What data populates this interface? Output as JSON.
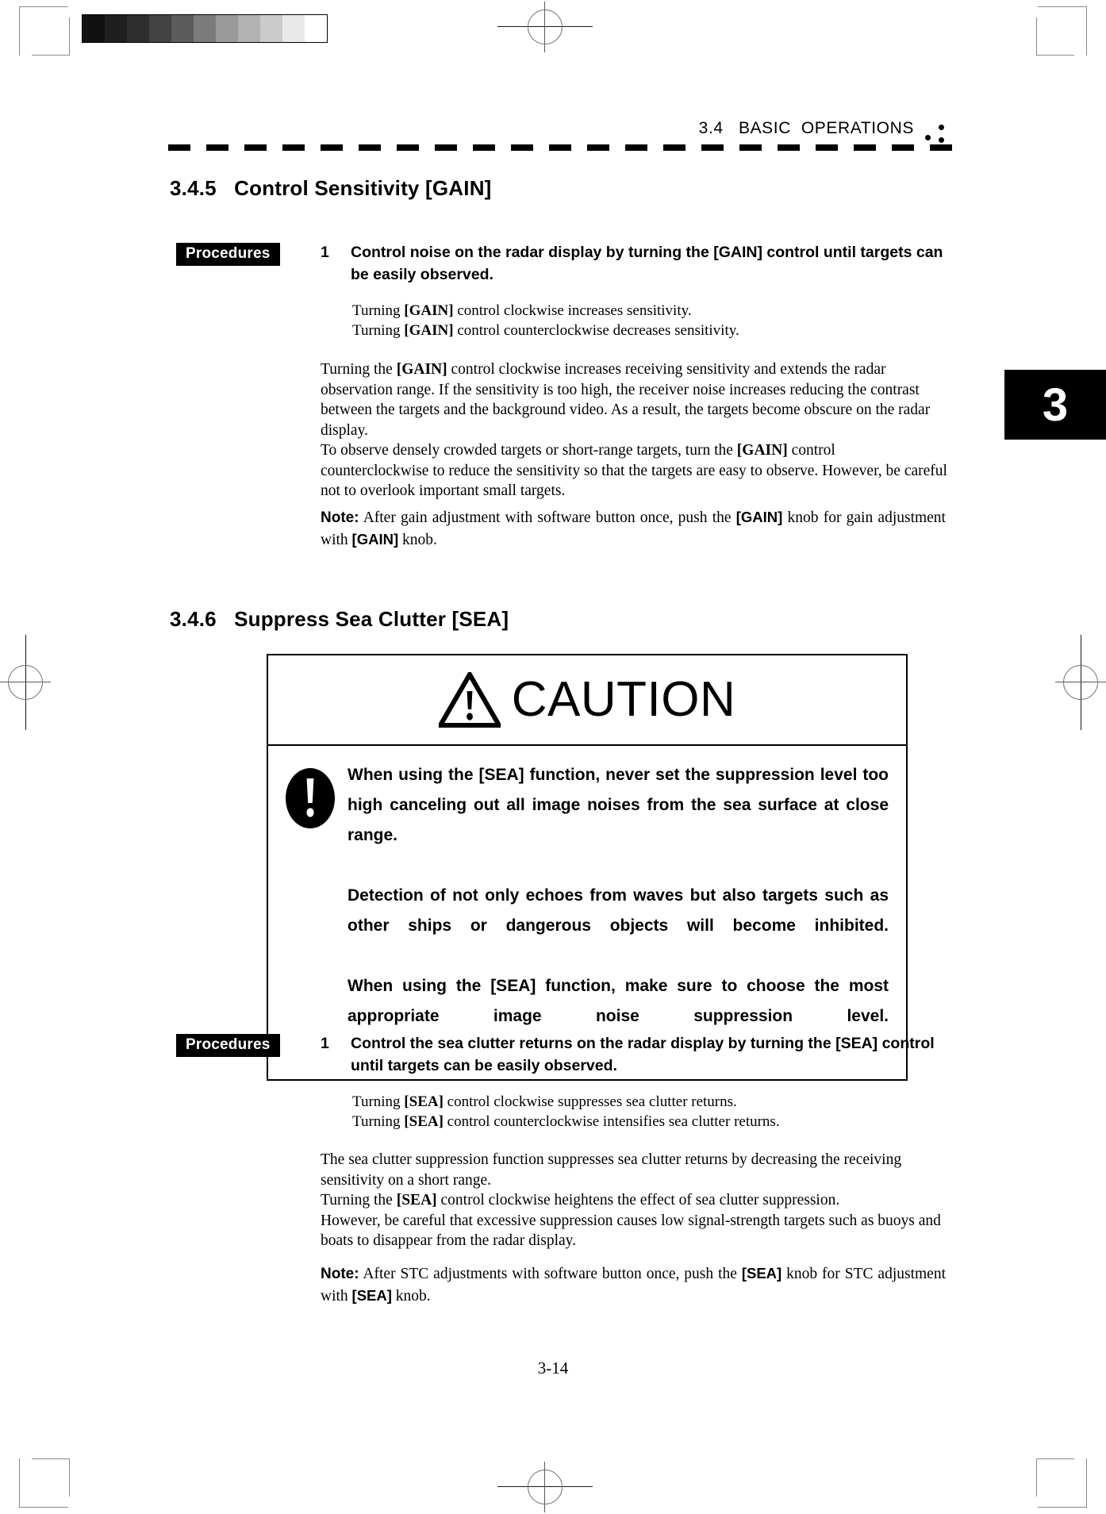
{
  "document": {
    "page_number": "3-14",
    "chapter_tab": "3",
    "header": {
      "section_number": "3.4",
      "section_title": "BASIC  OPERATIONS",
      "full": "3.4   BASIC  OPERATIONS"
    }
  },
  "scan_marks": {
    "grayscale_steps": [
      "#111111",
      "#1f1f1f",
      "#2e2e2e",
      "#434343",
      "#5c5c5c",
      "#7b7b7b",
      "#9a9a9a",
      "#b2b2b2",
      "#cbcbcb",
      "#e9e9e9",
      "#ffffff"
    ]
  },
  "sections": [
    {
      "id": "3.4.5",
      "number": "3.4.5",
      "title": "Control Sensitivity [GAIN]",
      "heading": "3.4.5   Control Sensitivity [GAIN]",
      "procedures_label": "Procedures",
      "step": {
        "number": "1",
        "text": "Control noise on the radar display by turning the [GAIN] control until targets can be easily observed."
      },
      "subtext_lines": [
        {
          "prefix": "Turning ",
          "key": "[GAIN]",
          "suffix": " control clockwise increases sensitivity."
        },
        {
          "prefix": "Turning ",
          "key": "[GAIN]",
          "suffix": " control counterclockwise decreases sensitivity."
        }
      ],
      "body_paragraph_1": {
        "part1": "Turning the ",
        "key1": "[GAIN]",
        "part2": " control clockwise increases receiving sensitivity and extends the radar observation range.    If the sensitivity is too high, the receiver noise increases reducing the contrast between the targets and the background video.    As a result, the targets become obscure on the radar display."
      },
      "body_paragraph_2": {
        "part1": "To observe densely crowded targets or short-range targets, turn the ",
        "key1": "[GAIN]",
        "part2": " control counterclockwise to reduce the sensitivity so that the targets are easy to observe.    However, be careful not to overlook important small targets."
      },
      "note": {
        "label": "Note:",
        "part1": "After gain adjustment with software button once, push the ",
        "key1": "[GAIN]",
        "part2": " knob for gain adjustment with ",
        "key2": "[GAIN]",
        "part3": " knob."
      }
    },
    {
      "id": "3.4.6",
      "number": "3.4.6",
      "title": "Suppress Sea Clutter [SEA]",
      "heading": "3.4.6   Suppress Sea Clutter [SEA]",
      "procedures_label": "Procedures",
      "caution": {
        "title": "CAUTION",
        "warning_icon": "warning-triangle-icon",
        "notice_icon": "exclamation-oval-icon",
        "paragraphs": [
          "When using the [SEA] function, never set the suppression level too high canceling out all image noises from the sea surface at close range.",
          "Detection of not only echoes from waves but also targets such as other ships or dangerous objects will become inhibited.",
          "When using the [SEA] function, make sure to choose the most appropriate image noise suppression level."
        ]
      },
      "step": {
        "number": "1",
        "text": "Control the sea clutter returns on the radar display by turning the [SEA] control until targets can be easily observed."
      },
      "subtext_lines": [
        {
          "prefix": "Turning ",
          "key": "[SEA]",
          "suffix": " control clockwise suppresses sea clutter returns."
        },
        {
          "prefix": "Turning ",
          "key": "[SEA]",
          "suffix": " control counterclockwise intensifies sea clutter returns."
        }
      ],
      "body_paragraph_1": {
        "part1": "The sea clutter suppression function suppresses sea clutter returns by decreasing the receiving sensitivity on a short range.",
        "key1": "",
        "part2": ""
      },
      "body_paragraph_2": {
        "part1": "Turning the ",
        "key1": "[SEA]",
        "part2": " control clockwise heightens the effect of sea clutter suppression."
      },
      "body_paragraph_3": {
        "part1": "However, be careful that excessive suppression causes low signal-strength targets such as buoys and boats to disappear from the radar display."
      },
      "note": {
        "label": "Note:",
        "part1": "After STC adjustments with software button once, push the ",
        "key1": "[SEA]",
        "part2": " knob for STC adjustment with ",
        "key2": "[SEA]",
        "part3": " knob."
      }
    }
  ]
}
